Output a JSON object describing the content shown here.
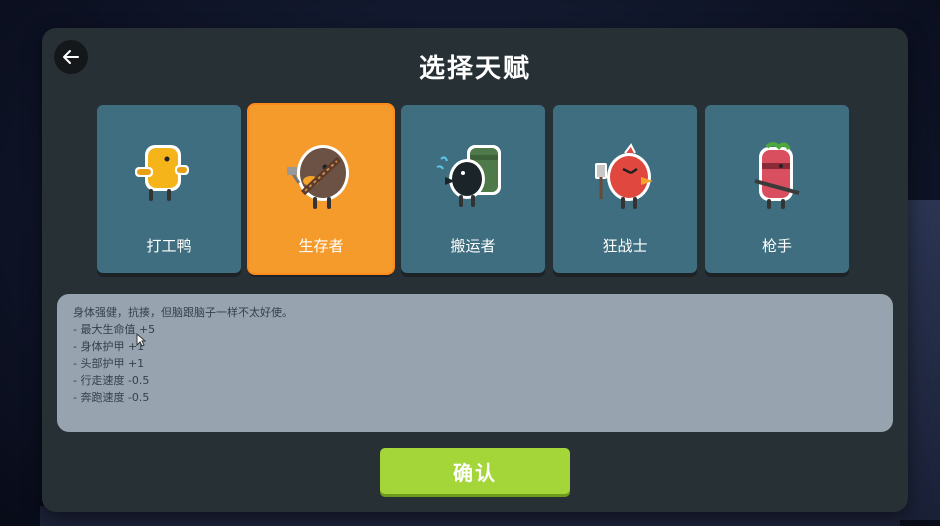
{
  "dialog": {
    "title": "选择天赋",
    "back_icon": "arrow-left-icon"
  },
  "cards": [
    {
      "label": "打工鸭",
      "icon": "worker-duck-icon",
      "selected": false
    },
    {
      "label": "生存者",
      "icon": "survivor-duck-icon",
      "selected": true
    },
    {
      "label": "搬运者",
      "icon": "porter-duck-icon",
      "selected": false
    },
    {
      "label": "狂战士",
      "icon": "berserker-duck-icon",
      "selected": false
    },
    {
      "label": "枪手",
      "icon": "gunner-duck-icon",
      "selected": false
    }
  ],
  "description": {
    "lines": [
      "身体强健，抗揍，但脑跟脑子一样不太好使。",
      "- 最大生命值 +5",
      "- 身体护甲 +1",
      "- 头部护甲 +1",
      "- 行走速度 -0.5",
      "- 奔跑速度 -0.5"
    ]
  },
  "confirm_button": {
    "label": "确认"
  },
  "colors": {
    "dialog_bg": "#273034",
    "card_bg": "#3e6e7f",
    "card_selected": "#f59b2c",
    "desc_bg": "#97a4b0",
    "confirm_bg": "#a4d63a"
  }
}
